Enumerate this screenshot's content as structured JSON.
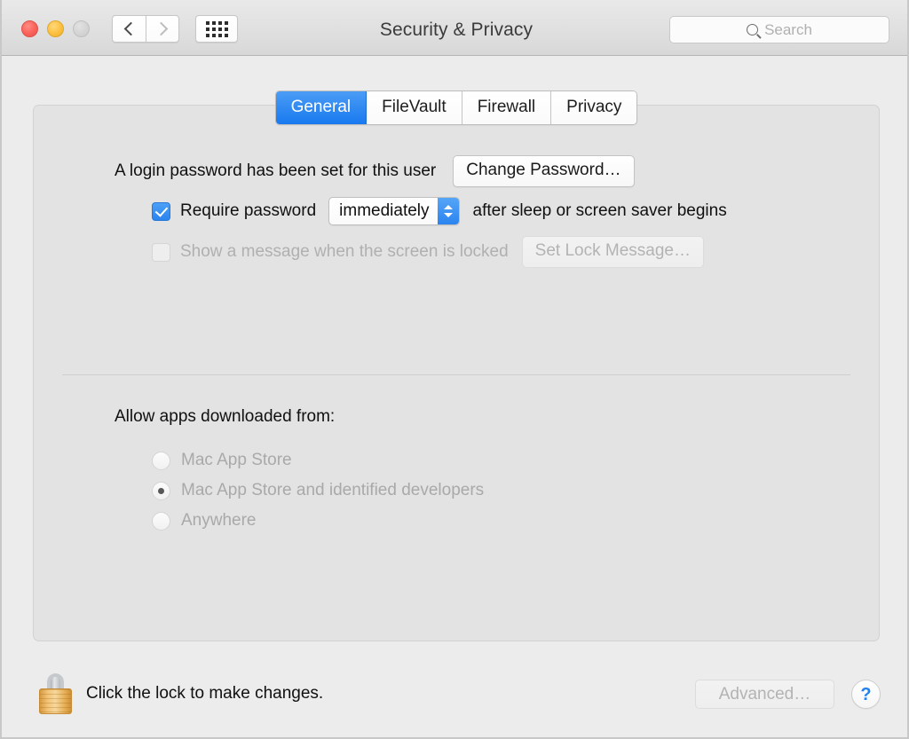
{
  "window": {
    "title": "Security & Privacy",
    "traffic_lights": [
      {
        "name": "close",
        "color": "#fa6159"
      },
      {
        "name": "minimize",
        "color": "#fcbf3f"
      },
      {
        "name": "zoom",
        "color": "#d4d4d4"
      }
    ],
    "nav": {
      "back_icon": "chevron-left-icon",
      "forward_icon": "chevron-right-icon",
      "showall_icon": "grid-icon"
    },
    "search": {
      "placeholder": "Search",
      "value": "",
      "icon": "search-icon"
    }
  },
  "tabs": [
    {
      "label": "General",
      "active": true
    },
    {
      "label": "FileVault",
      "active": false
    },
    {
      "label": "Firewall",
      "active": false
    },
    {
      "label": "Privacy",
      "active": false
    }
  ],
  "general": {
    "login_password_text": "A login password has been set for this user",
    "change_password_button": "Change Password…",
    "require_password": {
      "checked": true,
      "label": "Require password",
      "popup_value": "immediately",
      "suffix": "after sleep or screen saver begins"
    },
    "lock_message": {
      "checked": false,
      "enabled": false,
      "label": "Show a message when the screen is locked",
      "button": "Set Lock Message…"
    },
    "allow_apps": {
      "heading": "Allow apps downloaded from:",
      "enabled": false,
      "options": [
        {
          "label": "Mac App Store",
          "selected": false
        },
        {
          "label": "Mac App Store and identified developers",
          "selected": true
        },
        {
          "label": "Anywhere",
          "selected": false
        }
      ]
    }
  },
  "footer": {
    "lock_icon": "padlock-closed-icon",
    "lock_text": "Click the lock to make changes.",
    "advanced_button": "Advanced…",
    "advanced_enabled": false,
    "help_button": "?"
  },
  "colors": {
    "accent_blue": "#1879ef",
    "window_bg": "#ececec",
    "panel_bg": "#e3e3e3",
    "disabled_text": "#b0b0b0"
  }
}
